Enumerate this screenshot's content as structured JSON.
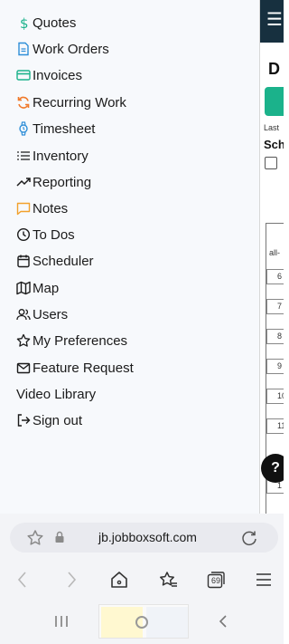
{
  "drawer": {
    "items": [
      {
        "label": "Quotes",
        "icon": "dollar-icon",
        "color": "#1bb28b"
      },
      {
        "label": "Work Orders",
        "icon": "document-icon",
        "color": "#2f8fd8"
      },
      {
        "label": "Invoices",
        "icon": "credit-card-icon",
        "color": "#1bb28b"
      },
      {
        "label": "Recurring Work",
        "icon": "recurring-icon",
        "color": "#f07a2b"
      },
      {
        "label": "Timesheet",
        "icon": "watch-icon",
        "color": "#2f8fd8"
      },
      {
        "label": "Inventory",
        "icon": "list-icon",
        "color": "#1b1b1b"
      },
      {
        "label": "Reporting",
        "icon": "trend-up-icon",
        "color": "#1b1b1b"
      },
      {
        "label": "Notes",
        "icon": "comment-icon",
        "color": "#f2a12b"
      },
      {
        "label": "To Dos",
        "icon": "clock-icon",
        "color": "#1b1b1b"
      },
      {
        "label": "Scheduler",
        "icon": "calendar-icon",
        "color": "#1b1b1b"
      },
      {
        "label": "Map",
        "icon": "map-icon",
        "color": "#1b1b1b"
      },
      {
        "label": "Users",
        "icon": "users-icon",
        "color": "#1b1b1b"
      },
      {
        "label": "My Preferences",
        "icon": "star-icon",
        "color": "#1b1b1b"
      },
      {
        "label": "Feature Request",
        "icon": "mail-icon",
        "color": "#1b1b1b"
      },
      {
        "label": "Video Library",
        "icon": "",
        "color": "#1b1b1b"
      },
      {
        "label": "Sign out",
        "icon": "sign-out-icon",
        "color": "#1b1b1b"
      }
    ]
  },
  "background_page": {
    "title": "D",
    "last_label": "Last",
    "section_label": "Sch",
    "filter_label": "all-",
    "row_numbers": [
      "6",
      "7",
      "8",
      "9",
      "10",
      "11",
      "1"
    ],
    "help_label": "?",
    "brand_color": "#1bb28b",
    "nav_color": "#17303f"
  },
  "browser": {
    "url": "jb.jobboxsoft.com",
    "tabs_count": "69"
  }
}
